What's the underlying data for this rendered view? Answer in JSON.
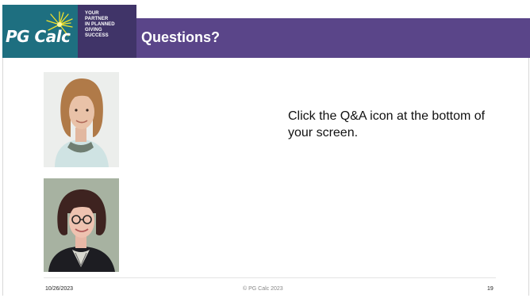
{
  "brand": {
    "logo_text": "PG Calc",
    "tagline": [
      "YOUR",
      "PARTNER",
      "IN PLANNED",
      "GIVING",
      "SUCCESS"
    ],
    "colors": {
      "teal": "#1e6f80",
      "purple_dark": "#403468",
      "purple": "#5a4589",
      "star": "#f2e12b"
    }
  },
  "slide": {
    "title": "Questions?",
    "body": "Click the Q&A icon at the bottom of your screen.",
    "photos": [
      "presenter-photo",
      "presenter-photo"
    ]
  },
  "footer": {
    "date": "10/26/2023",
    "copyright": "© PG Calc 2023",
    "page": "19"
  }
}
